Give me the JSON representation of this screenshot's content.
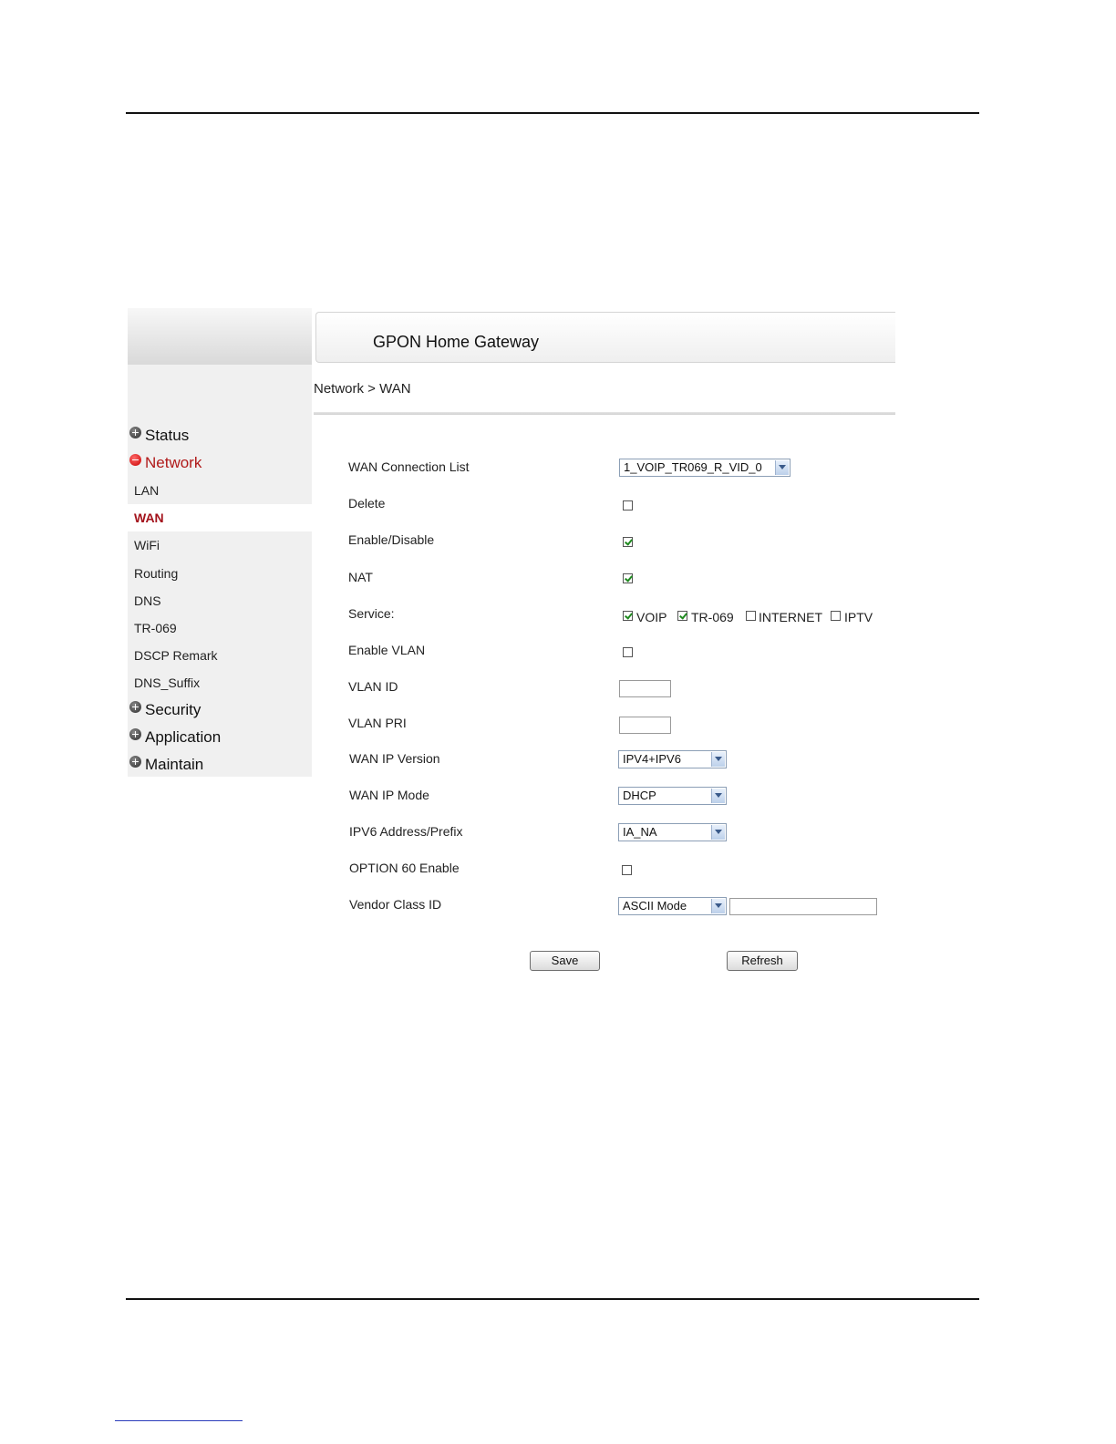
{
  "app": {
    "title": "GPON Home Gateway"
  },
  "breadcrumb": "Network > WAN",
  "sidebar": {
    "groups": [
      {
        "label": "Status",
        "expanded": false
      },
      {
        "label": "Network",
        "expanded": true
      },
      {
        "label": "Security",
        "expanded": false
      },
      {
        "label": "Application",
        "expanded": false
      },
      {
        "label": "Maintain",
        "expanded": false
      }
    ],
    "network_items": [
      "LAN",
      "WAN",
      "WiFi",
      "Routing",
      "DNS",
      "TR-069",
      "DSCP Remark",
      "DNS_Suffix"
    ],
    "selected_item": "WAN"
  },
  "form": {
    "wan_connection_list": {
      "label": "WAN Connection List",
      "value": "1_VOIP_TR069_R_VID_0"
    },
    "delete": {
      "label": "Delete",
      "checked": false
    },
    "enable_disable": {
      "label": "Enable/Disable",
      "checked": true
    },
    "nat": {
      "label": "NAT",
      "checked": true
    },
    "service": {
      "label": "Service:",
      "options": [
        {
          "label": "VOIP",
          "checked": true
        },
        {
          "label": "TR-069",
          "checked": true
        },
        {
          "label": "INTERNET",
          "checked": false
        },
        {
          "label": "IPTV",
          "checked": false
        }
      ]
    },
    "enable_vlan": {
      "label": "Enable VLAN",
      "checked": false
    },
    "vlan_id": {
      "label": "VLAN ID",
      "value": ""
    },
    "vlan_pri": {
      "label": "VLAN PRI",
      "value": ""
    },
    "wan_ip_version": {
      "label": "WAN IP Version",
      "value": "IPV4+IPV6"
    },
    "wan_ip_mode": {
      "label": "WAN IP Mode",
      "value": "DHCP"
    },
    "ipv6_address_prefix": {
      "label": "IPV6 Address/Prefix",
      "value": "IA_NA"
    },
    "option60_enable": {
      "label": "OPTION 60 Enable",
      "checked": false
    },
    "vendor_class_id": {
      "label": "Vendor Class ID",
      "mode": "ASCII Mode",
      "value": ""
    }
  },
  "buttons": {
    "save": "Save",
    "refresh": "Refresh"
  }
}
